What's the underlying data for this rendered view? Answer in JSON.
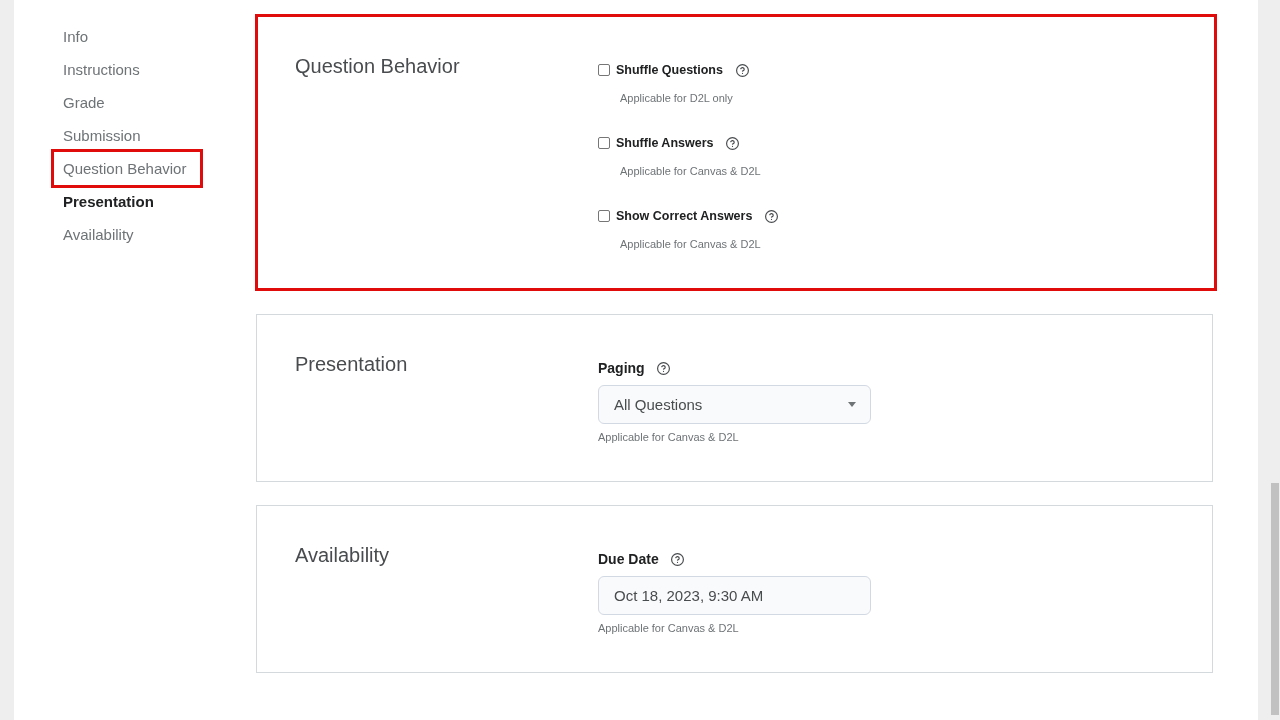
{
  "sidebar": {
    "items": [
      {
        "label": "Info",
        "selected": false,
        "highlighted": false
      },
      {
        "label": "Instructions",
        "selected": false,
        "highlighted": false
      },
      {
        "label": "Grade",
        "selected": false,
        "highlighted": false
      },
      {
        "label": "Submission",
        "selected": false,
        "highlighted": false
      },
      {
        "label": "Question Behavior",
        "selected": false,
        "highlighted": true
      },
      {
        "label": "Presentation",
        "selected": true,
        "highlighted": false
      },
      {
        "label": "Availability",
        "selected": false,
        "highlighted": false
      }
    ]
  },
  "sections": [
    {
      "title": "Question Behavior",
      "highlighted": true,
      "fields": [
        {
          "kind": "checkbox",
          "label": "Shuffle Questions",
          "checked": false,
          "help": true,
          "note": "Applicable for D2L only"
        },
        {
          "kind": "checkbox",
          "label": "Shuffle Answers",
          "checked": false,
          "help": true,
          "note": "Applicable for Canvas & D2L"
        },
        {
          "kind": "checkbox",
          "label": "Show Correct Answers",
          "checked": false,
          "help": true,
          "note": "Applicable for Canvas & D2L"
        }
      ]
    },
    {
      "title": "Presentation",
      "highlighted": false,
      "fields": [
        {
          "kind": "select",
          "label": "Paging",
          "help": true,
          "value": "All Questions",
          "note": "Applicable for Canvas & D2L"
        }
      ]
    },
    {
      "title": "Availability",
      "highlighted": false,
      "fields": [
        {
          "kind": "date",
          "label": "Due Date",
          "help": true,
          "value": "Oct 18, 2023, 9:30 AM",
          "note": "Applicable for Canvas & D2L"
        }
      ]
    }
  ]
}
